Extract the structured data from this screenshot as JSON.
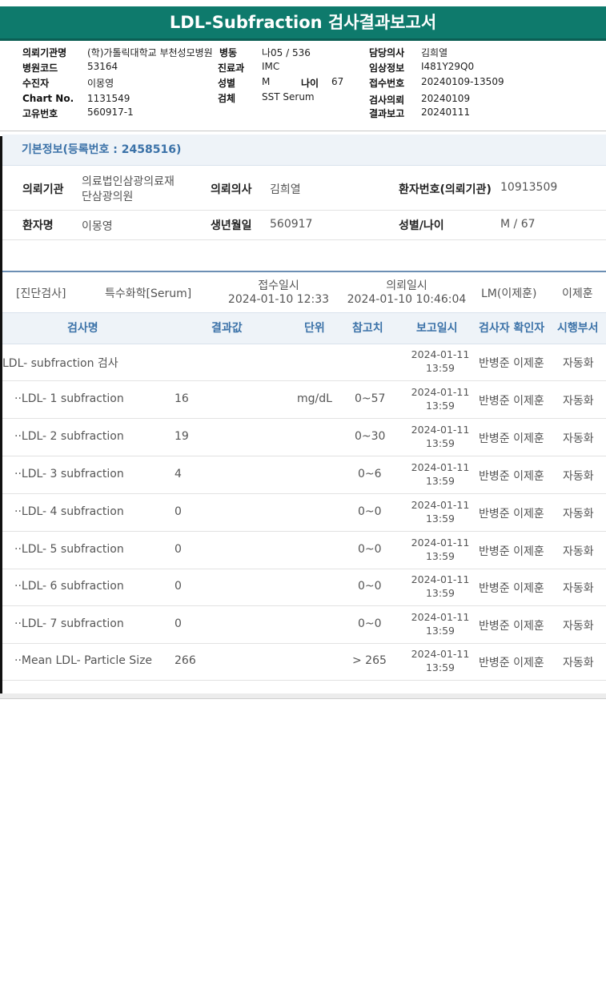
{
  "title": "LDL-Subfraction 검사결과보고서",
  "header": {
    "hospital_label": "의뢰기관명",
    "hospital_value": "(학)가톨릭대학교 부천성모병원",
    "ward_label": "병동",
    "ward_value": "나05 / 536",
    "doctor_label": "담당의사",
    "doctor_value": "김희열",
    "hosp_code_label": "병원코드",
    "hosp_code_value": "53164",
    "dept_label": "진료과",
    "dept_value": "IMC",
    "clinical_label": "임상정보",
    "clinical_value": "I481Y29Q0",
    "patient_label": "수진자",
    "patient_value": "이몽영",
    "sex_label": "성별",
    "sex_value": "M",
    "age_label": "나이",
    "age_value": "67",
    "receipt_no_label": "접수번호",
    "receipt_no_value": "20240109-13509",
    "chart_label": "Chart No.",
    "chart_value": "1131549",
    "specimen_label": "검체",
    "specimen_value": "SST Serum",
    "request_label": "검사의뢰",
    "request_value": "20240109",
    "unique_label": "고유번호",
    "unique_value": "560917-1",
    "report_label": "결과보고",
    "report_value": "20240111"
  },
  "basic": {
    "section_title": "기본정보(등록번호 : 2458516)",
    "inst_label": "의뢰기관",
    "inst_value_1": "의료법인삼광의료재",
    "inst_value_2": "단삼광의원",
    "doc_label": "의뢰의사",
    "doc_value": "김희열",
    "pid_label": "환자번호(의뢰기관)",
    "pid_value": "10913509",
    "name_label": "환자명",
    "name_value": "이몽영",
    "dob_label": "생년월일",
    "dob_value": "560917",
    "sexage_label": "성별/나이",
    "sexage_value": "M / 67"
  },
  "request": {
    "category": "[진단검사]",
    "type": "특수화학[Serum]",
    "receipt_label": "접수일시",
    "receipt_value": "2024-01-10 12:33",
    "request_label": "의뢰일시",
    "request_value": "2024-01-10 10:46:04",
    "lm": "LM(이제훈)",
    "confirmer": "이제훈"
  },
  "table": {
    "headers": [
      "검사명",
      "결과값",
      "단위",
      "참고치",
      "보고일시",
      "검사자 확인자",
      "시행부서"
    ],
    "rows": [
      {
        "name": "LDL- subfraction 검사",
        "result": "",
        "unit": "",
        "ref": "",
        "date": "2024-01-11",
        "time": "13:59",
        "staff": "반병준 이제훈",
        "dept": "자동화"
      },
      {
        "name": "··LDL- 1 subfraction",
        "result": "16",
        "unit": "mg/dL",
        "ref": "0~57",
        "date": "2024-01-11",
        "time": "13:59",
        "staff": "반병준 이제훈",
        "dept": "자동화"
      },
      {
        "name": "··LDL- 2 subfraction",
        "result": "19",
        "unit": "",
        "ref": "0~30",
        "date": "2024-01-11",
        "time": "13:59",
        "staff": "반병준 이제훈",
        "dept": "자동화"
      },
      {
        "name": "··LDL- 3 subfraction",
        "result": "4",
        "unit": "",
        "ref": "0~6",
        "date": "2024-01-11",
        "time": "13:59",
        "staff": "반병준 이제훈",
        "dept": "자동화"
      },
      {
        "name": "··LDL- 4 subfraction",
        "result": "0",
        "unit": "",
        "ref": "0~0",
        "date": "2024-01-11",
        "time": "13:59",
        "staff": "반병준 이제훈",
        "dept": "자동화"
      },
      {
        "name": "··LDL- 5 subfraction",
        "result": "0",
        "unit": "",
        "ref": "0~0",
        "date": "2024-01-11",
        "time": "13:59",
        "staff": "반병준 이제훈",
        "dept": "자동화"
      },
      {
        "name": "··LDL- 6 subfraction",
        "result": "0",
        "unit": "",
        "ref": "0~0",
        "date": "2024-01-11",
        "time": "13:59",
        "staff": "반병준 이제훈",
        "dept": "자동화"
      },
      {
        "name": "··LDL- 7 subfraction",
        "result": "0",
        "unit": "",
        "ref": "0~0",
        "date": "2024-01-11",
        "time": "13:59",
        "staff": "반병준 이제훈",
        "dept": "자동화"
      },
      {
        "name": "··Mean LDL- Particle Size",
        "result": "266",
        "unit": "",
        "ref": "> 265",
        "date": "2024-01-11",
        "time": "13:59",
        "staff": "반병준 이제훈",
        "dept": "자동화"
      }
    ]
  }
}
